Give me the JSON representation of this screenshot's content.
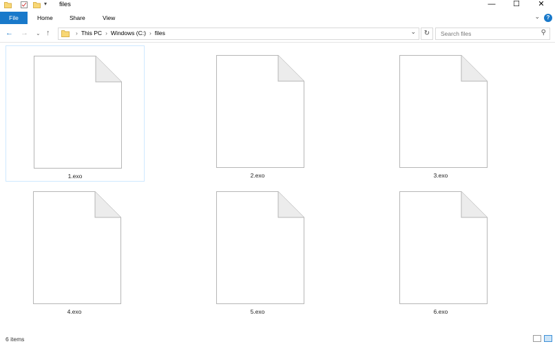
{
  "window": {
    "title": "files",
    "minimize_glyph": "—",
    "maximize_glyph": "☐",
    "close_glyph": "✕"
  },
  "ribbon": {
    "tabs": [
      "File",
      "Home",
      "Share",
      "View"
    ],
    "help_glyph": "?"
  },
  "address": {
    "crumbs": [
      "This PC",
      "Windows (C:)",
      "files"
    ]
  },
  "search": {
    "placeholder": "Search files"
  },
  "files": [
    {
      "name": "1.exo",
      "selected": true
    },
    {
      "name": "2.exo",
      "selected": false
    },
    {
      "name": "3.exo",
      "selected": false
    },
    {
      "name": "4.exo",
      "selected": false
    },
    {
      "name": "5.exo",
      "selected": false
    },
    {
      "name": "6.exo",
      "selected": false
    }
  ],
  "status": {
    "item_count": "6 items"
  },
  "colors": {
    "accent": "#1979ca",
    "selection_border": "#cde8ff"
  }
}
